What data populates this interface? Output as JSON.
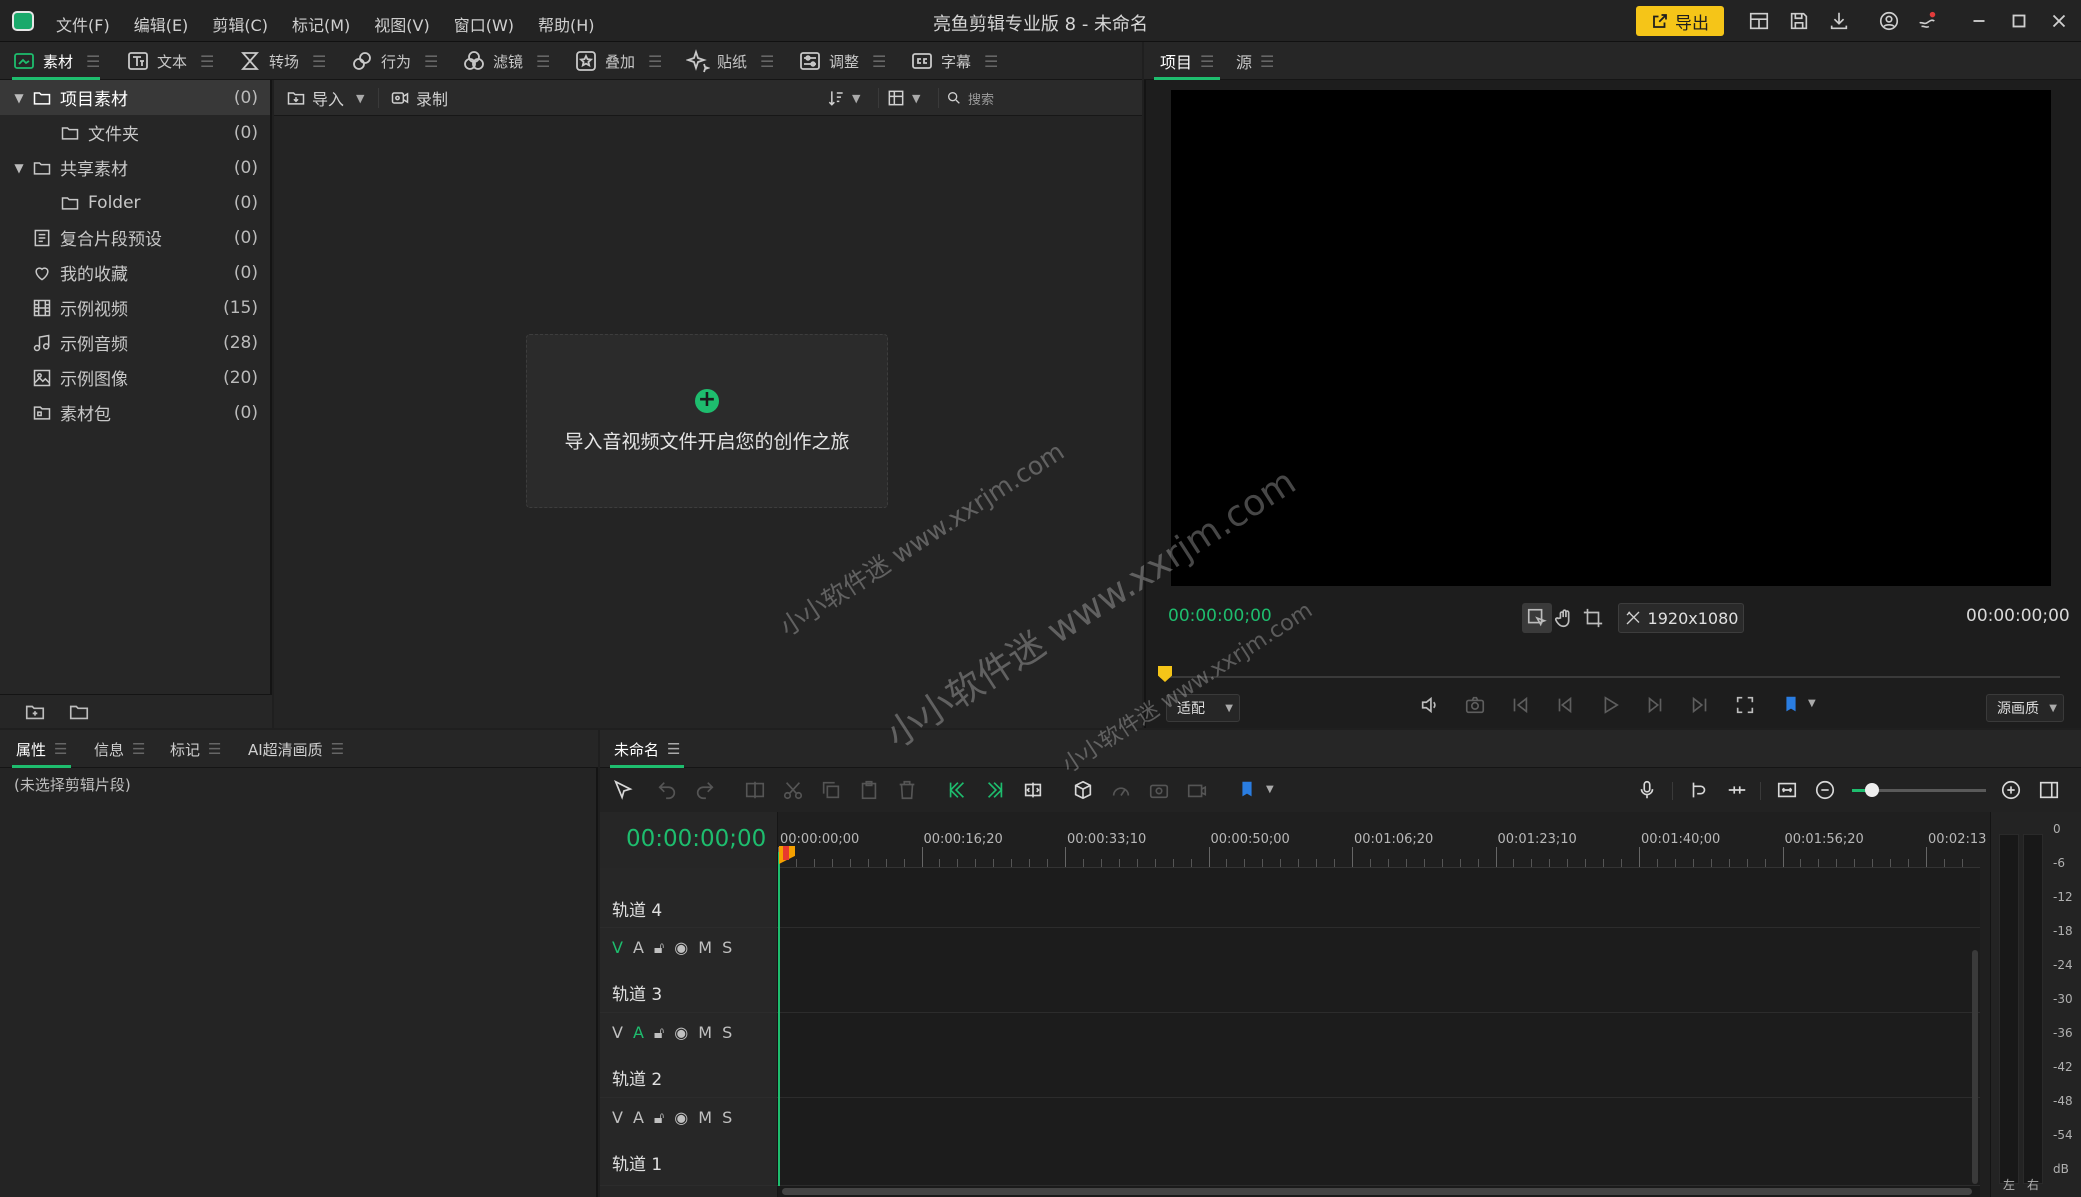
{
  "app": {
    "title": "亮鱼剪辑专业版 8 - 未命名",
    "accent": "#1ebd6e",
    "highlight": "#f5c518"
  },
  "menu": [
    "文件(F)",
    "编辑(E)",
    "剪辑(C)",
    "标记(M)",
    "视图(V)",
    "窗口(W)",
    "帮助(H)"
  ],
  "toolbar": {
    "export_label": "导出",
    "icons": [
      "layout-icon",
      "save-icon",
      "download-icon",
      "account-icon",
      "notification-icon",
      "minimize-icon",
      "maximize-icon",
      "close-icon"
    ]
  },
  "categories": [
    {
      "label": "素材",
      "icon": "media-icon",
      "active": true
    },
    {
      "label": "文本",
      "icon": "text-icon"
    },
    {
      "label": "转场",
      "icon": "transition-icon"
    },
    {
      "label": "行为",
      "icon": "behavior-icon"
    },
    {
      "label": "滤镜",
      "icon": "filter-icon"
    },
    {
      "label": "叠加",
      "icon": "overlay-icon"
    },
    {
      "label": "贴纸",
      "icon": "sticker-icon"
    },
    {
      "label": "调整",
      "icon": "adjust-icon"
    },
    {
      "label": "字幕",
      "icon": "caption-icon"
    }
  ],
  "sidebar": {
    "items": [
      {
        "label": "项目素材",
        "count": "(0)",
        "icon": "folder-icon",
        "expanded": true,
        "selected": true
      },
      {
        "label": "文件夹",
        "count": "(0)",
        "icon": "folder-icon",
        "child": true
      },
      {
        "label": "共享素材",
        "count": "(0)",
        "icon": "folder-icon",
        "expanded": true
      },
      {
        "label": "Folder",
        "count": "(0)",
        "icon": "folder-icon",
        "child": true
      },
      {
        "label": "复合片段预设",
        "count": "(0)",
        "icon": "compound-clip-icon"
      },
      {
        "label": "我的收藏",
        "count": "(0)",
        "icon": "heart-icon"
      },
      {
        "label": "示例视频",
        "count": "(15)",
        "icon": "film-icon"
      },
      {
        "label": "示例音频",
        "count": "(28)",
        "icon": "music-icon"
      },
      {
        "label": "示例图像",
        "count": "(20)",
        "icon": "image-icon"
      },
      {
        "label": "素材包",
        "count": "(0)",
        "icon": "package-icon"
      }
    ]
  },
  "media": {
    "import_label": "导入",
    "record_label": "录制",
    "search_placeholder": "搜索",
    "dropzone_text": "导入音视频文件开启您的创作之旅"
  },
  "preview": {
    "tabs": [
      "项目",
      "源"
    ],
    "time_left": "00:00:00;00",
    "time_right": "00:00:00;00",
    "resolution": "1920x1080",
    "fit_label": "适配",
    "quality_label": "源画质"
  },
  "props": {
    "tabs": [
      "属性",
      "信息",
      "标记",
      "AI超清画质"
    ],
    "empty_note": "(未选择剪辑片段)"
  },
  "timeline": {
    "tab_label": "未命名",
    "current_time": "00:00:00;00",
    "ruler": [
      "00:00:00;00",
      "00:00:16;20",
      "00:00:33;10",
      "00:00:50;00",
      "00:01:06;20",
      "00:01:23;10",
      "00:01:40;00",
      "00:01:56;20",
      "00:02:13"
    ],
    "tracks": [
      {
        "name": "轨道 4"
      },
      {
        "name": "轨道 3"
      },
      {
        "name": "轨道 2"
      },
      {
        "name": "轨道 1"
      }
    ],
    "track_controls": [
      "V",
      "A",
      "M",
      "S"
    ],
    "zoom_level": 0.15
  },
  "meter": {
    "scale": [
      "0",
      "-6",
      "-12",
      "-18",
      "-24",
      "-30",
      "-36",
      "-42",
      "-48",
      "-54",
      "dB"
    ],
    "left": "左",
    "right": "右"
  },
  "watermark": {
    "text1": "小小软件迷 www.xxrjm.com",
    "text2": "小小软件迷 www.xxrjm.com",
    "text3": "小小软件迷 www.xxrjm.com"
  }
}
